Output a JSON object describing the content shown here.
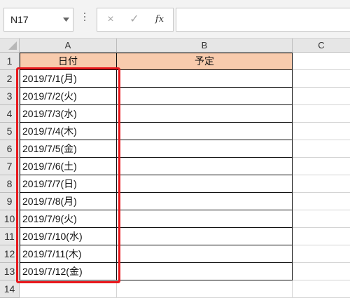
{
  "name_box": {
    "value": "N17"
  },
  "formula_bar": {
    "cancel_icon": "×",
    "enter_icon": "✓",
    "fx_label": "fx",
    "content": ""
  },
  "columns": [
    "A",
    "B",
    "C"
  ],
  "header_row": {
    "row": "1",
    "date_label": "日付",
    "plan_label": "予定"
  },
  "rows": [
    {
      "row": "2",
      "date": "2019/7/1(月)"
    },
    {
      "row": "3",
      "date": "2019/7/2(火)"
    },
    {
      "row": "4",
      "date": "2019/7/3(水)"
    },
    {
      "row": "5",
      "date": "2019/7/4(木)"
    },
    {
      "row": "6",
      "date": "2019/7/5(金)"
    },
    {
      "row": "7",
      "date": "2019/7/6(土)"
    },
    {
      "row": "8",
      "date": "2019/7/7(日)"
    },
    {
      "row": "9",
      "date": "2019/7/8(月)"
    },
    {
      "row": "10",
      "date": "2019/7/9(火)"
    },
    {
      "row": "11",
      "date": "2019/7/10(水)"
    },
    {
      "row": "12",
      "date": "2019/7/11(木)"
    },
    {
      "row": "13",
      "date": "2019/7/12(金)"
    }
  ],
  "extra_row": "14",
  "colors": {
    "header_fill": "#f8cbad",
    "highlight_border": "#e8191d"
  }
}
